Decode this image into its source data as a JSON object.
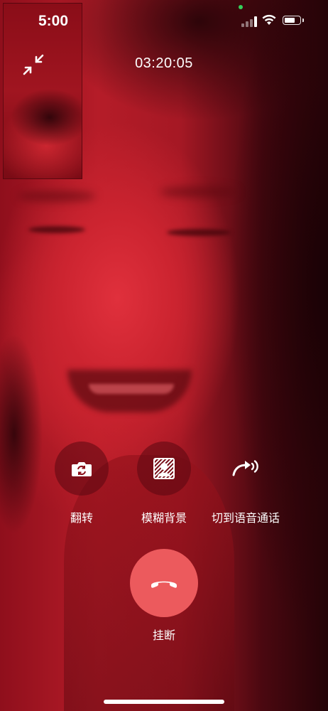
{
  "status_bar": {
    "time": "5:00"
  },
  "call": {
    "duration": "03:20:05"
  },
  "controls": {
    "flip": {
      "label": "翻转",
      "icon": "camera-flip-icon"
    },
    "blur_background": {
      "label": "模糊背景",
      "icon": "blur-background-icon"
    },
    "switch_to_voice": {
      "label": "切到语音通话",
      "icon": "switch-to-voice-icon"
    }
  },
  "hangup": {
    "label": "挂断",
    "icon": "hang-up-icon"
  },
  "pip": {
    "icon": "minimize-icon"
  },
  "colors": {
    "hangup_button": "#ec5a5d",
    "video_tint": "#cc2430",
    "mic_indicator": "#35d05a"
  }
}
